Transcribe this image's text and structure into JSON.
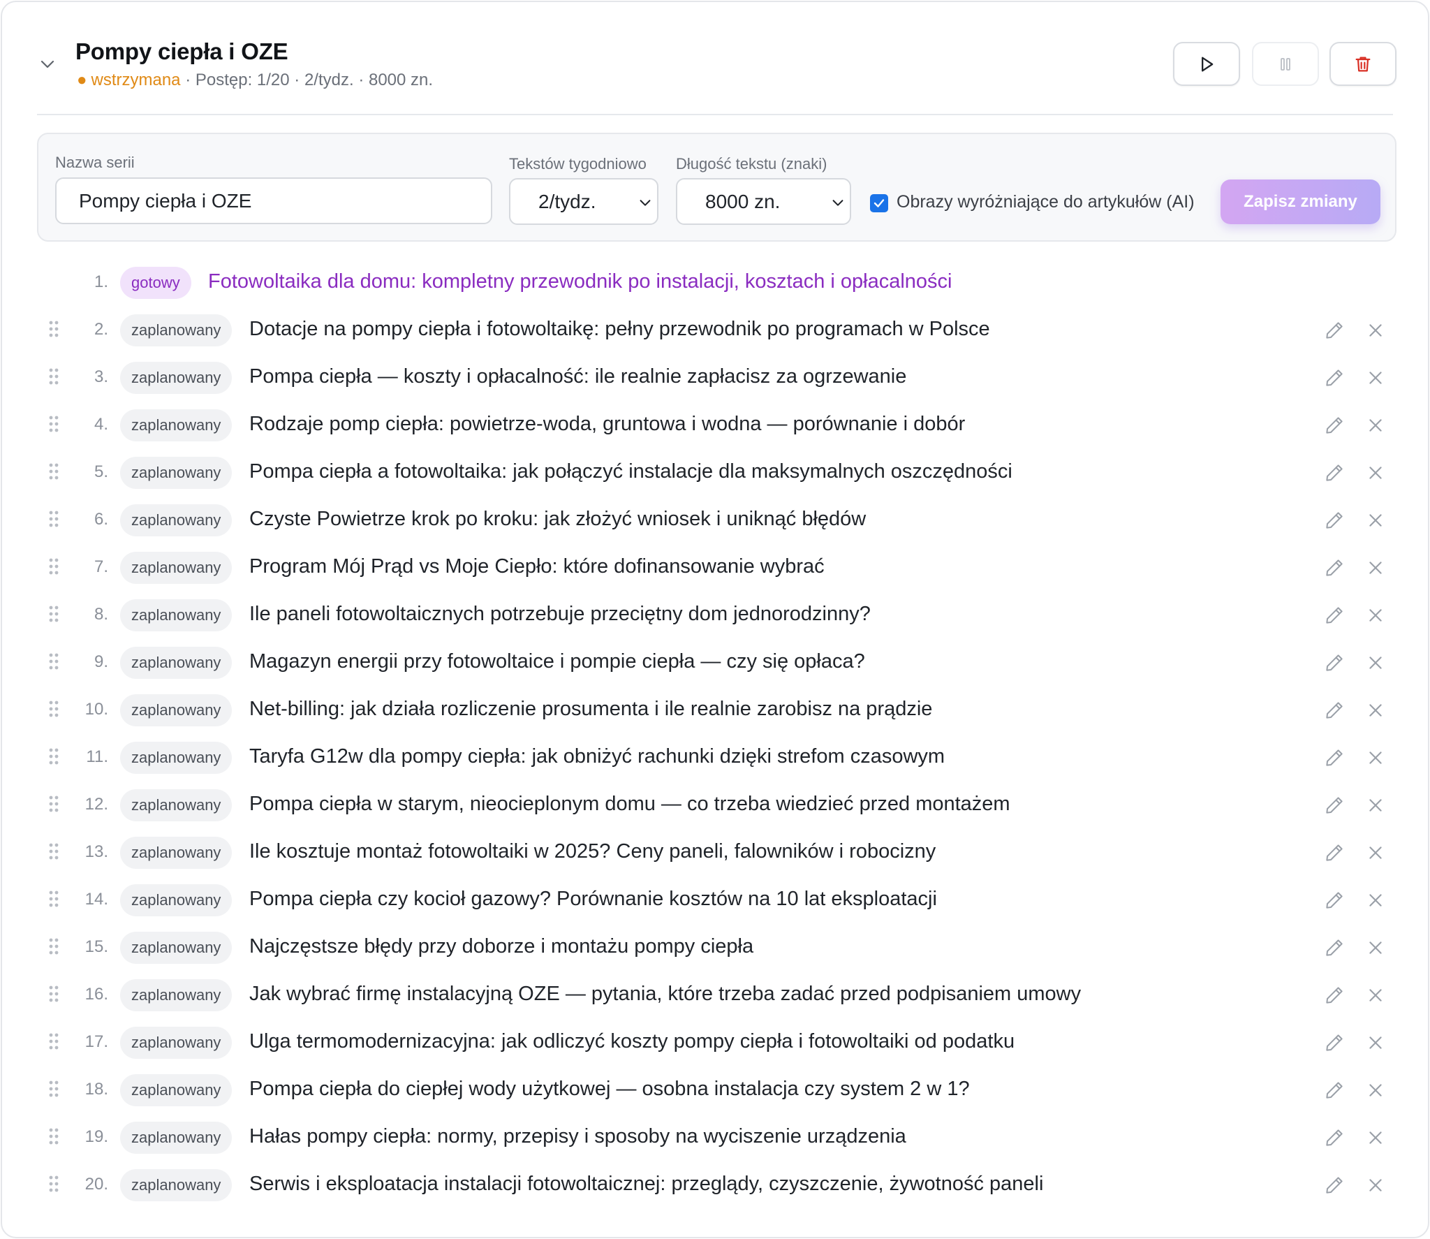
{
  "series": {
    "title": "Pompy ciepła i OZE",
    "status_dot": "●",
    "status": "wstrzymana",
    "meta": " · Postęp: 1/20 · 2/tydz. · 8000 zn."
  },
  "form": {
    "name_label": "Nazwa serii",
    "name_value": "Pompy ciepła i OZE",
    "weekly_label": "Tekstów tygodniowo",
    "weekly_value": "2/tydz.",
    "length_label": "Długość tekstu (znaki)",
    "length_value": "8000 zn.",
    "images_label": "Obrazy wyróżniające do artykułów (AI)",
    "images_checked": true,
    "save_label": "Zapisz zmiany"
  },
  "colors": {
    "accent_purple": "#8a2cc0",
    "status_orange": "#e08a16",
    "checkbox_blue": "#1a73e8",
    "delete_red": "#d93025"
  },
  "items": [
    {
      "num": "1.",
      "status": "gotowy",
      "title": "Fotowoltaika dla domu: kompletny przewodnik po instalacji, kosztach i opłacalności"
    },
    {
      "num": "2.",
      "status": "zaplanowany",
      "title": "Dotacje na pompy ciepła i fotowoltaikę: pełny przewodnik po programach w Polsce"
    },
    {
      "num": "3.",
      "status": "zaplanowany",
      "title": "Pompa ciepła — koszty i opłacalność: ile realnie zapłacisz za ogrzewanie"
    },
    {
      "num": "4.",
      "status": "zaplanowany",
      "title": "Rodzaje pomp ciepła: powietrze-woda, gruntowa i wodna — porównanie i dobór"
    },
    {
      "num": "5.",
      "status": "zaplanowany",
      "title": "Pompa ciepła a fotowoltaika: jak połączyć instalacje dla maksymalnych oszczędności"
    },
    {
      "num": "6.",
      "status": "zaplanowany",
      "title": "Czyste Powietrze krok po kroku: jak złożyć wniosek i uniknąć błędów"
    },
    {
      "num": "7.",
      "status": "zaplanowany",
      "title": "Program Mój Prąd vs Moje Ciepło: które dofinansowanie wybrać"
    },
    {
      "num": "8.",
      "status": "zaplanowany",
      "title": "Ile paneli fotowoltaicznych potrzebuje przeciętny dom jednorodzinny?"
    },
    {
      "num": "9.",
      "status": "zaplanowany",
      "title": "Magazyn energii przy fotowoltaice i pompie ciepła — czy się opłaca?"
    },
    {
      "num": "10.",
      "status": "zaplanowany",
      "title": "Net-billing: jak działa rozliczenie prosumenta i ile realnie zarobisz na prądzie"
    },
    {
      "num": "11.",
      "status": "zaplanowany",
      "title": "Taryfa G12w dla pompy ciepła: jak obniżyć rachunki dzięki strefom czasowym"
    },
    {
      "num": "12.",
      "status": "zaplanowany",
      "title": "Pompa ciepła w starym, nieocieplonym domu — co trzeba wiedzieć przed montażem"
    },
    {
      "num": "13.",
      "status": "zaplanowany",
      "title": "Ile kosztuje montaż fotowoltaiki w 2025? Ceny paneli, falowników i robocizny"
    },
    {
      "num": "14.",
      "status": "zaplanowany",
      "title": "Pompa ciepła czy kocioł gazowy? Porównanie kosztów na 10 lat eksploatacji"
    },
    {
      "num": "15.",
      "status": "zaplanowany",
      "title": "Najczęstsze błędy przy doborze i montażu pompy ciepła"
    },
    {
      "num": "16.",
      "status": "zaplanowany",
      "title": "Jak wybrać firmę instalacyjną OZE — pytania, które trzeba zadać przed podpisaniem umowy"
    },
    {
      "num": "17.",
      "status": "zaplanowany",
      "title": "Ulga termomodernizacyjna: jak odliczyć koszty pompy ciepła i fotowoltaiki od podatku"
    },
    {
      "num": "18.",
      "status": "zaplanowany",
      "title": "Pompa ciepła do ciepłej wody użytkowej — osobna instalacja czy system 2 w 1?"
    },
    {
      "num": "19.",
      "status": "zaplanowany",
      "title": "Hałas pompy ciepła: normy, przepisy i sposoby na wyciszenie urządzenia"
    },
    {
      "num": "20.",
      "status": "zaplanowany",
      "title": "Serwis i eksploatacja instalacji fotowoltaicznej: przeglądy, czyszczenie, żywotność paneli"
    }
  ]
}
